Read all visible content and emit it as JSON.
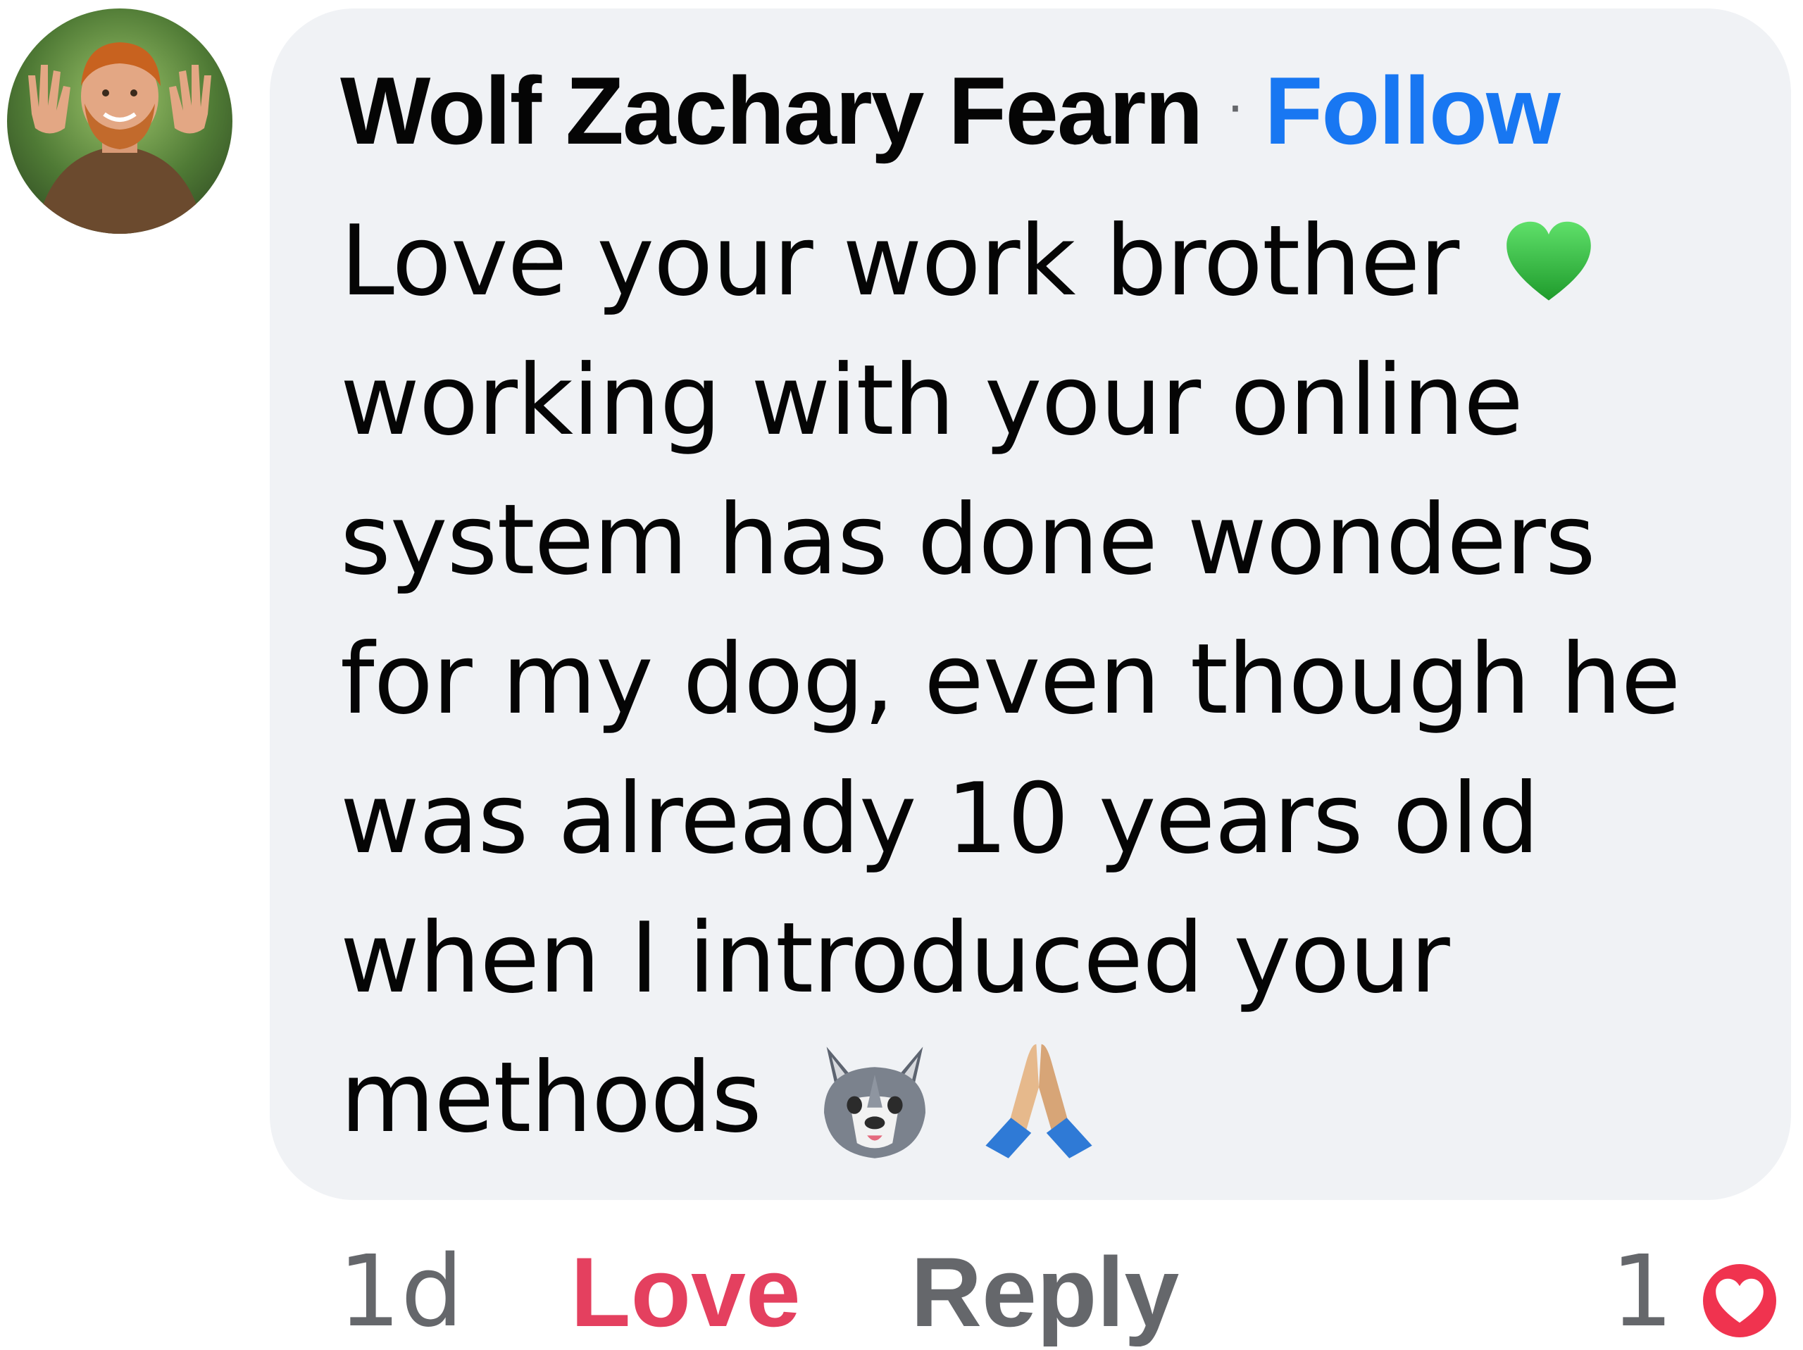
{
  "comment": {
    "author": "Wolf Zachary Fearn",
    "separator": "·",
    "follow_label": "Follow",
    "lines": [
      "Love your work brother",
      "working with your online",
      "system has done wonders",
      "for my dog, even though he",
      "was already 10 years old",
      "when I introduced your",
      "methods"
    ],
    "emojis": [
      "green-heart",
      "wolf-face",
      "folded-hands"
    ]
  },
  "footer": {
    "time": "1d",
    "love_label": "Love",
    "reply_label": "Reply",
    "reaction_count": "1",
    "reaction_icon": "heart-reaction-icon"
  },
  "colors": {
    "bubble": "#f0f2f5",
    "follow": "#1877f2",
    "love": "#e4405f",
    "muted": "#65676b",
    "text": "#050505"
  }
}
